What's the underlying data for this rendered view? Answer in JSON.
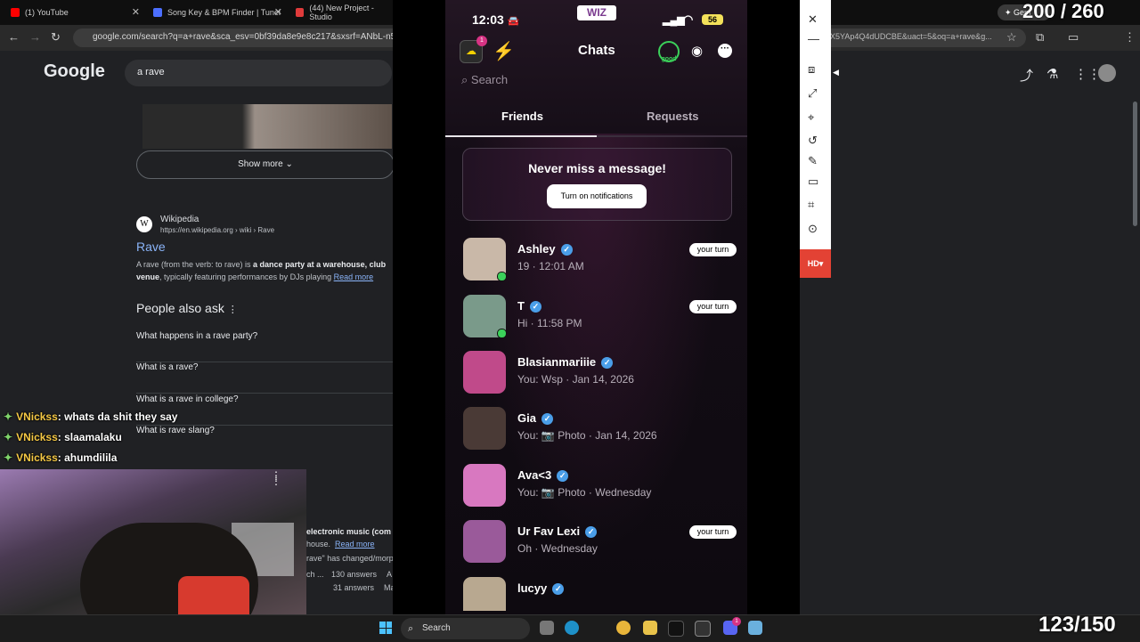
{
  "browser": {
    "tabs": [
      {
        "label": "(1) YouTube",
        "color": "#ff0000"
      },
      {
        "label": "Song Key & BPM Finder | Tunel",
        "color": "#4c6fff"
      },
      {
        "label": "(44) New Project - Studio",
        "color": "#e03b3b"
      }
    ],
    "url": "google.com/search?q=a+rave&sca_esv=0bf39da8e9e8c217&sxsrf=ANbL-n5BBdg",
    "url_tail": "X5YAp4Q4dUDCBE&uact=5&oq=a+rave&g...",
    "gemini_label": "✦ Gem"
  },
  "google": {
    "logo": "Google",
    "query": "a rave",
    "show_more": "Show more",
    "wiki": {
      "source": "Wikipedia",
      "url": "https://en.wikipedia.org › wiki › Rave",
      "title": "Rave",
      "snippet_a": "A rave (from the verb: to rave) is ",
      "snippet_b": "a dance party at a warehouse, club",
      "snippet_c": "venue",
      "snippet_d": ", typically featuring performances by DJs playing",
      "read_more": "Read more"
    },
    "paa_title": "People also ask",
    "questions": [
      "What happens in a rave party?",
      "What is a rave?",
      "What is a rave in college?",
      "What is rave slang?"
    ],
    "cut_texts": [
      "electronic music (com",
      "house.",
      "Read more",
      "rave\" has changed/morp",
      "ch ...",
      "130 answers",
      "A",
      "31 answers",
      "Ma"
    ]
  },
  "chat_overlay": [
    {
      "nick": "VNickss",
      "msg": ": whats da shit they say"
    },
    {
      "nick": "VNickss",
      "msg": ": slaamalaku"
    },
    {
      "nick": "VNickss",
      "msg": ": ahumdilila"
    }
  ],
  "phone": {
    "time": "12:03",
    "battery": "56",
    "logo": "WIZ",
    "title": "Chats",
    "coin_badge": "1",
    "good_label": "good",
    "search_placeholder": "Search",
    "tab_friends": "Friends",
    "tab_requests": "Requests",
    "notif_title": "Never miss a message!",
    "notif_button": "Turn on notifications",
    "turn_label": "your turn",
    "friends": [
      {
        "name": "Ashley",
        "sub": "19 · 12:01 AM",
        "turn": true,
        "online": true,
        "color": "#c9b8a8"
      },
      {
        "name": "T",
        "sub": "Hi · 11:58 PM",
        "turn": true,
        "online": true,
        "color": "#7a9a8a"
      },
      {
        "name": "Blasianmariiie",
        "sub": "You: Wsp · Jan 14, 2026",
        "turn": false,
        "online": false,
        "color": "#c04a8a"
      },
      {
        "name": "Gia",
        "sub": "You: 📷 Photo · Jan 14, 2026",
        "turn": false,
        "online": false,
        "color": "#4a3a36"
      },
      {
        "name": "Ava<3",
        "sub": "You: 📷 Photo · Wednesday",
        "turn": false,
        "online": false,
        "color": "#d878c0"
      },
      {
        "name": "Ur Fav Lexi",
        "sub": "Oh · Wednesday",
        "turn": true,
        "online": false,
        "color": "#9a5a9a"
      },
      {
        "name": "lucyy",
        "sub": "",
        "turn": false,
        "online": false,
        "color": "#b8a890"
      }
    ]
  },
  "mirror_toolbar": {
    "hd_label": "HD▾"
  },
  "counters": {
    "top": "200 / 260",
    "bottom": "123/150"
  },
  "taskbar": {
    "search_label": "Search",
    "badge": "1"
  }
}
